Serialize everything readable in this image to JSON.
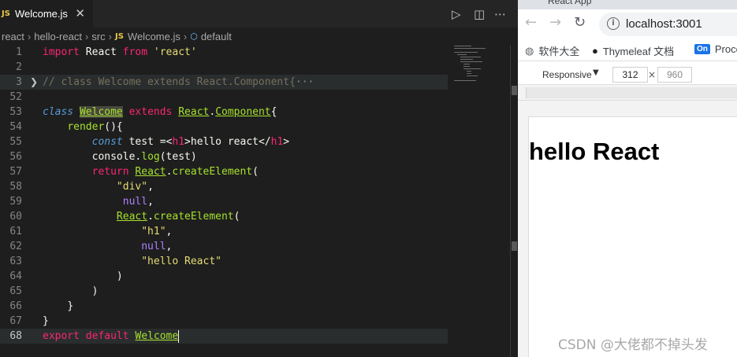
{
  "editor": {
    "tab": {
      "badge": "JS",
      "label": "Welcome.js",
      "close": "✕"
    },
    "toolbar_icons": [
      "run-icon",
      "split-editor-icon",
      "more-icon"
    ],
    "breadcrumb": {
      "parts": [
        "react",
        "hello-react",
        "src"
      ],
      "file_badge": "JS",
      "file": "Welcome.js",
      "symbol": "default"
    },
    "line_numbers": [
      "1",
      "2",
      "3",
      "52",
      "53",
      "54",
      "55",
      "56",
      "57",
      "58",
      "59",
      "60",
      "61",
      "62",
      "63",
      "64",
      "65",
      "66",
      "67",
      "68"
    ],
    "lines": {
      "l1": {
        "kw": "import",
        "name": " React ",
        "from": "from",
        "sp": " ",
        "str": "'react'"
      },
      "l3": {
        "comment": "// class Welcome extends React.Component{",
        "ellipsis": "···"
      },
      "l53": {
        "kw": "class",
        "sp1": " ",
        "name": "Welcome",
        "sp2": " ",
        "ext": "extends",
        "sp3": " ",
        "react": "React",
        "dot": ".",
        "comp": "Component",
        "brace": "{"
      },
      "l54": {
        "indent": "    ",
        "fn": "render",
        "rest": "(){"
      },
      "l55": {
        "indent": "        ",
        "kw": "const",
        "a": " test =<",
        "tag1": "h1",
        "b": ">hello react</",
        "tag2": "h1",
        "c": ">"
      },
      "l56": {
        "indent": "        ",
        "a": "console.",
        "fn": "log",
        "b": "(test)"
      },
      "l57": {
        "indent": "        ",
        "kw": "return",
        "sp": " ",
        "react": "React",
        "dot": ".",
        "fn": "createElement",
        "paren": "("
      },
      "l58": {
        "indent": "            ",
        "str": "\"div\"",
        "comma": ","
      },
      "l59": {
        "indent": "             ",
        "nul": "null",
        "comma": ","
      },
      "l60": {
        "indent": "            ",
        "react": "React",
        "dot": ".",
        "fn": "createElement",
        "paren": "("
      },
      "l61": {
        "indent": "                ",
        "str": "\"h1\"",
        "comma": ","
      },
      "l62": {
        "indent": "                ",
        "nul": "null",
        "comma": ","
      },
      "l63": {
        "indent": "                ",
        "str": "\"hello React\""
      },
      "l64": {
        "indent": "            ",
        "text": ")"
      },
      "l65": {
        "indent": "        ",
        "text": ")"
      },
      "l66": {
        "indent": "    ",
        "text": "}"
      },
      "l67": {
        "text": "}"
      },
      "l68": {
        "kw1": "export",
        "sp1": " ",
        "kw2": "default",
        "sp2": " ",
        "name": "Welcome"
      }
    }
  },
  "browser": {
    "tab_title": "React App",
    "url": "localhost:3001",
    "bookmarks": [
      {
        "icon": "globe-icon",
        "label": "软件大全"
      },
      {
        "icon": "github-icon",
        "label": "Thymeleaf 文档"
      },
      {
        "icon": "on-icon",
        "badge": "On",
        "label": "Proce"
      }
    ],
    "devtools": {
      "device": "Responsive",
      "width": "312",
      "times": "×",
      "height": "960"
    },
    "page_heading": "hello React"
  },
  "watermark": "CSDN @大佬都不掉头发",
  "colors": {
    "editor_bg": "#1e1e1e",
    "keyword": "#f92672",
    "class": "#a6e22e",
    "string": "#e6db74",
    "null": "#ae81ff",
    "comment": "#75715e"
  }
}
